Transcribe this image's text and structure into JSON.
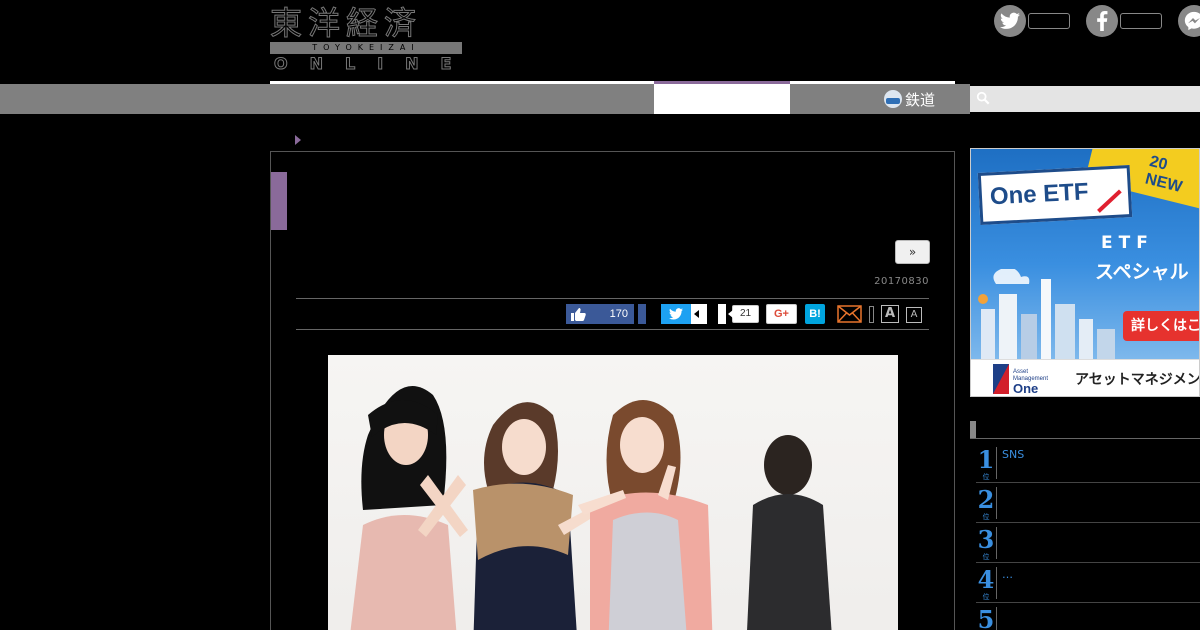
{
  "header": {
    "logo_kanji": "東洋経済",
    "logo_band": "TOYOKEIZAI",
    "logo_online": "ONLINE",
    "social": [
      {
        "name": "twitter",
        "glyph": "t"
      },
      {
        "name": "facebook",
        "glyph": "f"
      },
      {
        "name": "messenger",
        "glyph": "m"
      }
    ]
  },
  "nav": {
    "rail_label": "鉄道",
    "search_placeholder": ""
  },
  "article": {
    "next_label": "»",
    "date": "20170830",
    "share": {
      "fb_like_count": "170",
      "hatebu_count": "21",
      "gplus_label": "G+",
      "hatena_label": "B!",
      "font_large": "A",
      "font_small": "A"
    }
  },
  "ad": {
    "banner_new_line1": "20",
    "banner_new_line2": "NEW",
    "brand": "One ETF",
    "headline1": "ETF",
    "headline2": "スペシャル",
    "cta": "詳しくはこ",
    "sponsor_small1": "Asset",
    "sponsor_small2": "Management",
    "sponsor_big": "One",
    "sponsor_jp": "アセットマネジメント"
  },
  "ranking": {
    "unit": "位",
    "items": [
      {
        "rank": "1",
        "text": "SNS"
      },
      {
        "rank": "2",
        "text": ""
      },
      {
        "rank": "3",
        "text": ""
      },
      {
        "rank": "4",
        "text": "…"
      },
      {
        "rank": "5",
        "text": ""
      }
    ]
  }
}
